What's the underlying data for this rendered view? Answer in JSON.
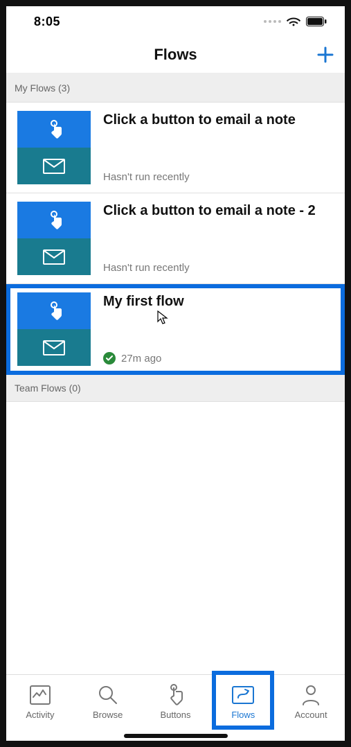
{
  "status": {
    "time": "8:05"
  },
  "header": {
    "title": "Flows"
  },
  "sections": {
    "myFlows": {
      "label": "My Flows (3)"
    },
    "teamFlows": {
      "label": "Team Flows (0)"
    }
  },
  "flows": [
    {
      "title": "Click a button to email a note",
      "status": "Hasn't run recently",
      "success": false
    },
    {
      "title": "Click a button to email a note - 2",
      "status": "Hasn't run recently",
      "success": false
    },
    {
      "title": "My first flow",
      "status": "27m ago",
      "success": true
    }
  ],
  "tabs": {
    "activity": "Activity",
    "browse": "Browse",
    "buttons": "Buttons",
    "flows": "Flows",
    "account": "Account"
  }
}
